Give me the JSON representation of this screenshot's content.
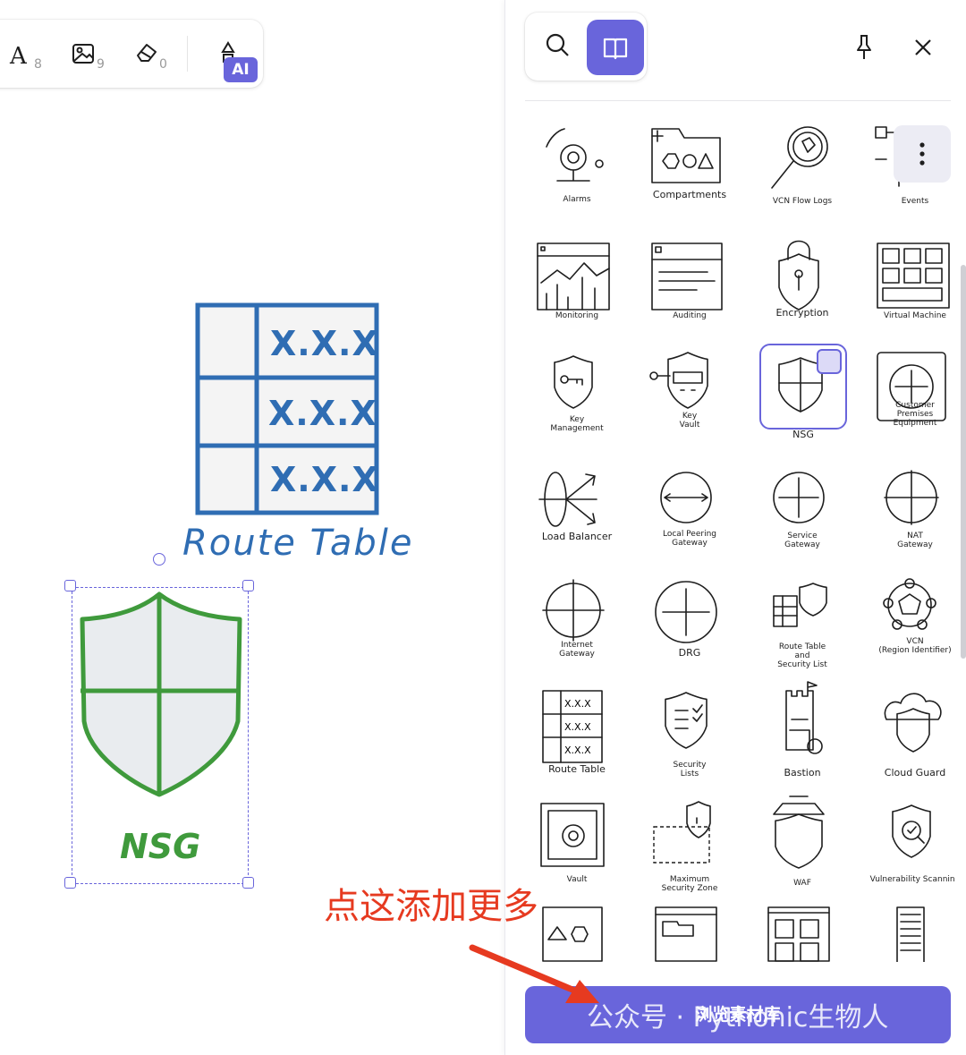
{
  "toolbar": {
    "tools": [
      {
        "icon": "text-icon",
        "count": "8"
      },
      {
        "icon": "image-icon",
        "count": "9"
      },
      {
        "icon": "eraser-icon",
        "count": "0"
      }
    ],
    "ai_badge": "AI"
  },
  "canvas": {
    "route_table": {
      "title": "Route Table",
      "cells": [
        "X.X.X",
        "X.X.X",
        "X.X.X"
      ],
      "color": "#2f6db3"
    },
    "nsg": {
      "label": "NSG",
      "color": "#3f9a3c"
    },
    "annotation": "点这添加更多",
    "annotation_color": "#e63a20"
  },
  "library": {
    "accent": "#6965db",
    "items": [
      {
        "label": "Alarms",
        "icon": "alarm-icon"
      },
      {
        "label": "Compartments",
        "icon": "compartments-icon"
      },
      {
        "label": "VCN Flow Logs",
        "icon": "vcn-flow-logs-icon"
      },
      {
        "label": "Events",
        "icon": "events-icon"
      },
      {
        "label": "Monitoring",
        "icon": "monitoring-icon"
      },
      {
        "label": "Auditing",
        "icon": "auditing-icon"
      },
      {
        "label": "Encryption",
        "icon": "encryption-icon"
      },
      {
        "label": "Virtual Machine",
        "icon": "virtual-machine-icon"
      },
      {
        "label": "Key\nManagement",
        "icon": "key-management-icon"
      },
      {
        "label": "Key\nVault",
        "icon": "key-vault-icon"
      },
      {
        "label": "NSG",
        "icon": "nsg-icon"
      },
      {
        "label": "Customer\nPremises\nEquipment",
        "icon": "customer-premises-equipment-icon"
      },
      {
        "label": "Load Balancer",
        "icon": "load-balancer-icon"
      },
      {
        "label": "Local Peering\nGateway",
        "icon": "local-peering-gateway-icon"
      },
      {
        "label": "Service\nGateway",
        "icon": "service-gateway-icon"
      },
      {
        "label": "NAT\nGateway",
        "icon": "nat-gateway-icon"
      },
      {
        "label": "Internet\nGateway",
        "icon": "internet-gateway-icon"
      },
      {
        "label": "DRG",
        "icon": "drg-icon"
      },
      {
        "label": "Route Table\nand\nSecurity List",
        "icon": "route-table-security-list-icon"
      },
      {
        "label": "VCN\n(Region Identifier)",
        "icon": "vcn-icon"
      },
      {
        "label": "Route Table",
        "icon": "route-table-icon"
      },
      {
        "label": "Security\nLists",
        "icon": "security-lists-icon"
      },
      {
        "label": "Bastion",
        "icon": "bastion-icon"
      },
      {
        "label": "Cloud Guard",
        "icon": "cloud-guard-icon"
      },
      {
        "label": "Vault",
        "icon": "vault-icon"
      },
      {
        "label": "Maximum\nSecurity Zone",
        "icon": "maximum-security-zone-icon"
      },
      {
        "label": "WAF",
        "icon": "waf-icon"
      },
      {
        "label": "Vulnerability Scanning",
        "icon": "vulnerability-scanning-icon"
      },
      {
        "label": "",
        "icon": "shapes-icon"
      },
      {
        "label": "",
        "icon": "window-icon"
      },
      {
        "label": "",
        "icon": "grid-icon"
      },
      {
        "label": "",
        "icon": "rack-icon"
      }
    ],
    "browse_button": "浏览素材库",
    "watermark": "公众号 · Pythonic生物人"
  }
}
